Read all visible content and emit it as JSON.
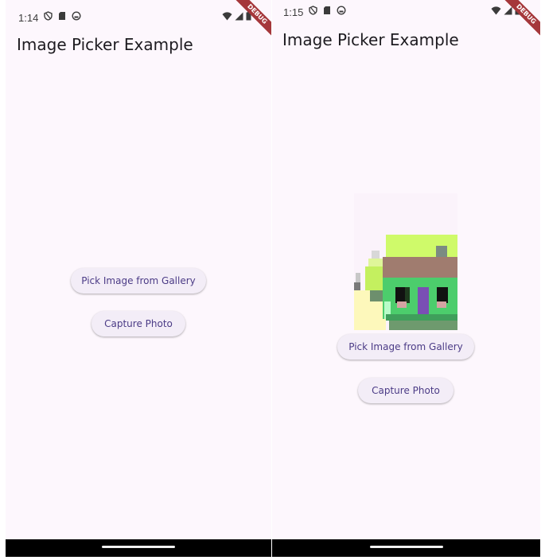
{
  "left_screen": {
    "status": {
      "time": "1:14"
    },
    "app_title": "Image Picker Example",
    "buttons": {
      "gallery": "Pick Image from Gallery",
      "camera": "Capture Photo"
    },
    "debug_banner": "DEBUG"
  },
  "right_screen": {
    "status": {
      "time": "1:15"
    },
    "app_title": "Image Picker Example",
    "buttons": {
      "gallery": "Pick Image from Gallery",
      "camera": "Capture Photo"
    },
    "debug_banner": "DEBUG"
  },
  "colors": {
    "background": "#fdf7fd",
    "button_bg": "#f3edf7",
    "button_text": "#4b3b86",
    "debug_ribbon": "#a5373b"
  },
  "icons": [
    "shield-icon",
    "sd-card-icon",
    "sync-icon",
    "wifi-icon",
    "signal-icon",
    "battery-icon"
  ]
}
